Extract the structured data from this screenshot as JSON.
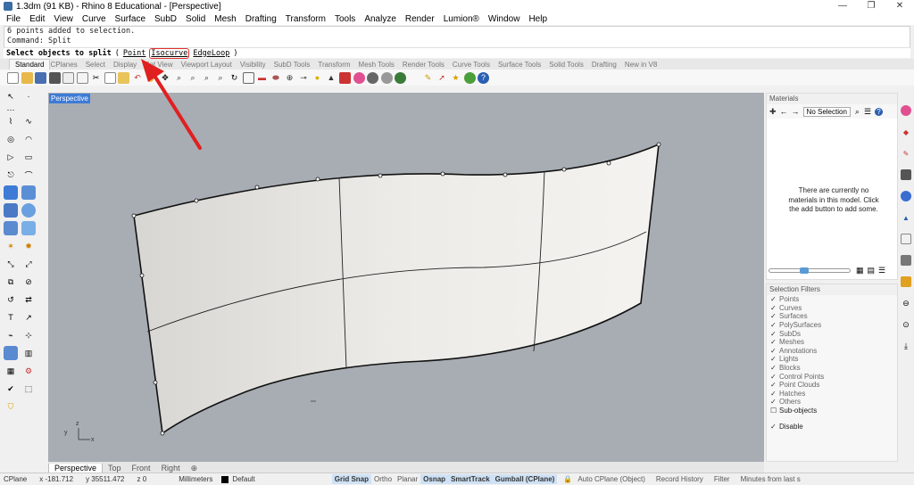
{
  "window": {
    "title": "1.3dm (91 KB) - Rhino 8 Educational - [Perspective]",
    "minimize": "—",
    "restore": "❐",
    "close": "✕"
  },
  "menu": [
    "File",
    "Edit",
    "View",
    "Curve",
    "Surface",
    "SubD",
    "Solid",
    "Mesh",
    "Drafting",
    "Transform",
    "Tools",
    "Analyze",
    "Render",
    "Lumion®",
    "Window",
    "Help"
  ],
  "command_history": [
    "6 points added to selection.",
    "Command: Split"
  ],
  "prompt": {
    "text": "Select objects to split",
    "open_paren": "(",
    "options": [
      "Point",
      "Isocurve",
      "EdgeLoop"
    ],
    "close_paren": ")"
  },
  "toolbar_tabs": [
    "Standard",
    "CPlanes",
    "Select",
    "Display",
    "Set View",
    "Viewport Layout",
    "Visibility",
    "SubD Tools",
    "Transform",
    "Mesh Tools",
    "Render Tools",
    "Curve Tools",
    "Surface Tools",
    "Solid Tools",
    "Drafting",
    "New in V8"
  ],
  "active_tab": "Standard",
  "viewport": {
    "label": "Perspective",
    "tabs": [
      "Perspective",
      "Top",
      "Front",
      "Right",
      "⊕"
    ],
    "axis_x": "x",
    "axis_y": "y",
    "axis_z": "z"
  },
  "materials": {
    "header": "Materials",
    "selection": "No Selection",
    "message": "There are currently no materials in this model. Click the add button to add some."
  },
  "selection_filters": {
    "header": "Selection Filters",
    "items": [
      "Points",
      "Curves",
      "Surfaces",
      "PolySurfaces",
      "SubDs",
      "Meshes",
      "Annotations",
      "Lights",
      "Blocks",
      "Control Points",
      "Point Clouds",
      "Hatches",
      "Others"
    ],
    "sub_objects": "Sub-objects",
    "disable": "Disable"
  },
  "status": {
    "cplane": "CPlane",
    "x": "x -181.712",
    "y": "y 35511.472",
    "z": "z 0",
    "units": "Millimeters",
    "layer": "Default",
    "grid_snap": "Grid Snap",
    "ortho": "Ortho",
    "planar": "Planar",
    "osnap": "Osnap",
    "smarttrack": "SmartTrack",
    "gumball": "Gumball (CPlane)",
    "auto_cplane": "Auto CPlane (Object)",
    "record_history": "Record History",
    "filter": "Filter",
    "minutes": "Minutes from last s"
  },
  "colors": {
    "accent": "#3d7bd6",
    "highlight": "#e03030",
    "viewport_bg": "#a8adb4",
    "surface": "#e4e3df"
  }
}
